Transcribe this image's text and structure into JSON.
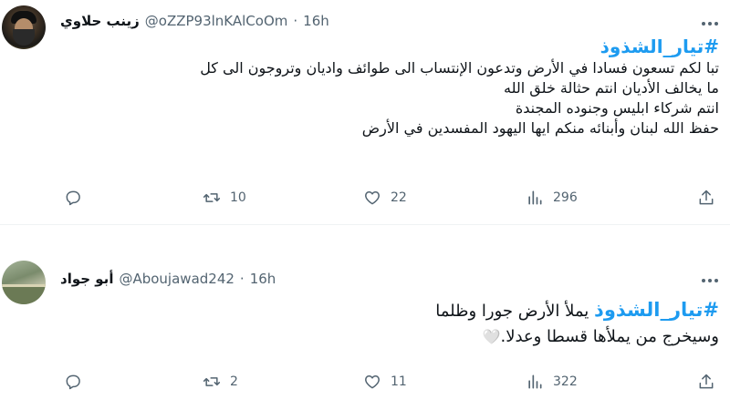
{
  "tweets": [
    {
      "display_name": "زينب حلاوي",
      "handle": "@oZZP93lnKAlCoOm",
      "separator": "·",
      "time": "16h",
      "hashtag": "#تيار_الشذوذ",
      "lines": [
        "تبا لكم تسعون فسادا في الأرض  وتدعون الإنتساب الى طوائف واديان وتروجون الى كل",
        "ما يخالف الأديان انتم حثالة خلق الله",
        "انتم شركاء ابليس وجنوده المجندة",
        "حفظ الله لبنان وأبنائه منكم ايها اليهود المفسدين في الأرض"
      ],
      "stats": {
        "reply": "",
        "retweets": "10",
        "likes": "22",
        "views": "296"
      }
    },
    {
      "display_name": "أبو جواد",
      "handle": "@Aboujawad242",
      "separator": "·",
      "time": "16h",
      "hashtag": "#تيار_الشذوذ",
      "line1_rest": " يملأ الأرض جورا وظلما",
      "line2": "وسيخرج من يملأها قسطا وعدلا.",
      "emoji": "🤍",
      "stats": {
        "reply": "",
        "retweets": "2",
        "likes": "11",
        "views": "322"
      }
    }
  ],
  "icons": {
    "more": "more-dots-icon",
    "reply": "reply-icon",
    "retweet": "retweet-icon",
    "like": "heart-icon",
    "views": "views-icon",
    "share": "share-icon"
  },
  "colors": {
    "text": "#0f1419",
    "muted": "#536471",
    "hashtag": "#1d9bf0",
    "separator": "#eff3f4"
  }
}
